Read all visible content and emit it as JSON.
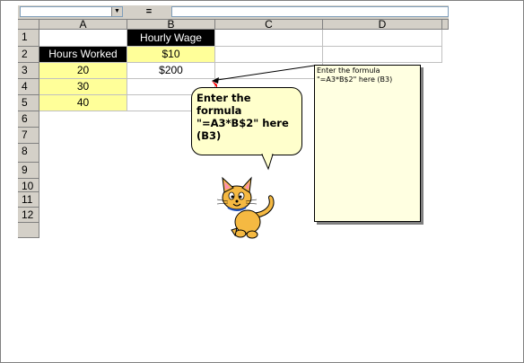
{
  "formula_bar": {
    "name_box": "",
    "dropdown_icon": "chevron-down-icon",
    "equals": "=",
    "formula": ""
  },
  "columns": [
    "A",
    "B",
    "C",
    "D"
  ],
  "rows": [
    "1",
    "2",
    "3",
    "4",
    "5",
    "6",
    "7",
    "8",
    "9",
    "10",
    "11",
    "12"
  ],
  "cells": {
    "B1": "Hourly Wage",
    "A2": "Hours Worked",
    "B2": "$10",
    "A3": "20",
    "B3": "$200",
    "A4": "30",
    "A5": "40"
  },
  "callout": {
    "text": "Enter the formula \"=A3*B$2\" here (B3)"
  },
  "comment": {
    "text": "Enter the formula \"=A3*B$2\" here (B3)"
  },
  "colors": {
    "yellow_fill": "#ffff99",
    "header_fill": "#000000",
    "callout_fill": "#ffffcc",
    "comment_fill": "#ffffe1"
  },
  "mascot": "cat-mascot"
}
